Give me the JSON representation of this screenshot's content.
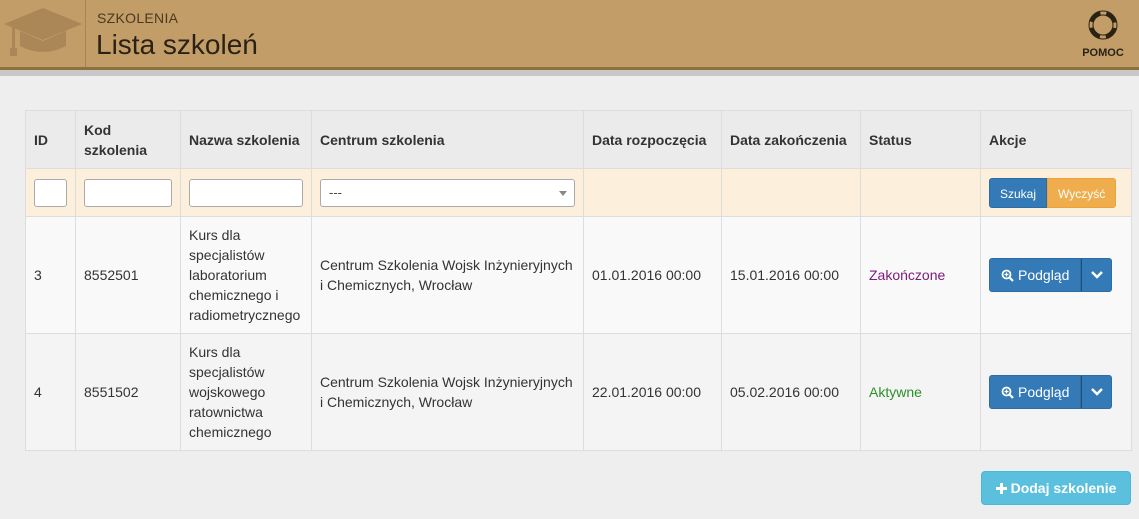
{
  "header": {
    "breadcrumb": "SZKOLENIA",
    "title": "Lista szkoleń",
    "help_label": "POMOC"
  },
  "table": {
    "columns": [
      "ID",
      "Kod szkolenia",
      "Nazwa szkolenia",
      "Centrum szkolenia",
      "Data rozpoczęcia",
      "Data zakończenia",
      "Status",
      "Akcje"
    ],
    "filters": {
      "select_value": "---",
      "search_label": "Szukaj",
      "clear_label": "Wyczyść"
    },
    "rows": [
      {
        "id": "3",
        "code": "8552501",
        "name": "Kurs dla specjalistów laboratorium chemicznego i radiometrycznego",
        "center": "Centrum Szkolenia Wojsk Inżynieryjnych i Chemicznych, Wrocław",
        "start": "01.01.2016 00:00",
        "end": "15.01.2016 00:00",
        "status": "Zakończone",
        "action": "Podgląd"
      },
      {
        "id": "4",
        "code": "8551502",
        "name": "Kurs dla specjalistów wojskowego ratownictwa chemicznego",
        "center": "Centrum Szkolenia Wojsk Inżynieryjnych i Chemicznych, Wrocław",
        "start": "22.01.2016 00:00",
        "end": "05.02.2016 00:00",
        "status": "Aktywne",
        "action": "Podgląd"
      }
    ]
  },
  "add_button_label": "Dodaj szkolenie",
  "colors": {
    "header_bg": "#c29d68",
    "primary": "#337ab7",
    "warning": "#f0ad4e",
    "info": "#5bc0de",
    "status_ended": "#7b1a7b",
    "status_active": "#2c8f2c"
  }
}
